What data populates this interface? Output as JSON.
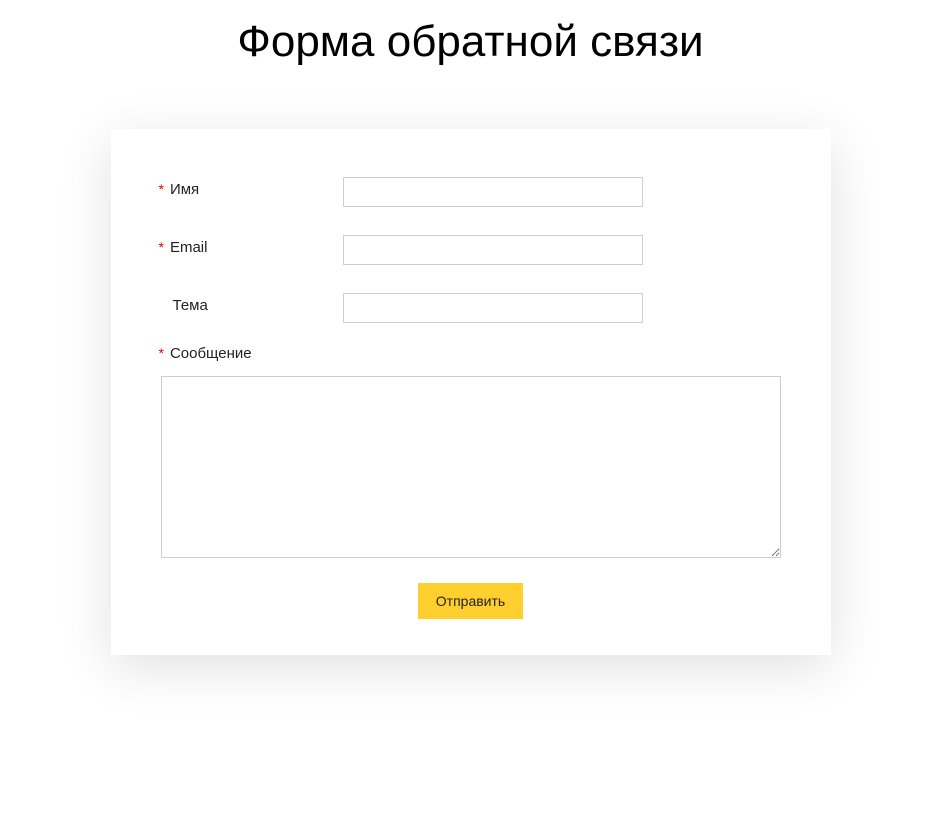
{
  "title": "Форма обратной связи",
  "required_marker": "*",
  "fields": {
    "name": {
      "label": "Имя",
      "value": "",
      "required": true
    },
    "email": {
      "label": "Email",
      "value": "",
      "required": true
    },
    "subject": {
      "label": "Тема",
      "value": "",
      "required": false
    },
    "message": {
      "label": "Сообщение",
      "value": "",
      "required": true
    }
  },
  "submit_label": "Отправить"
}
